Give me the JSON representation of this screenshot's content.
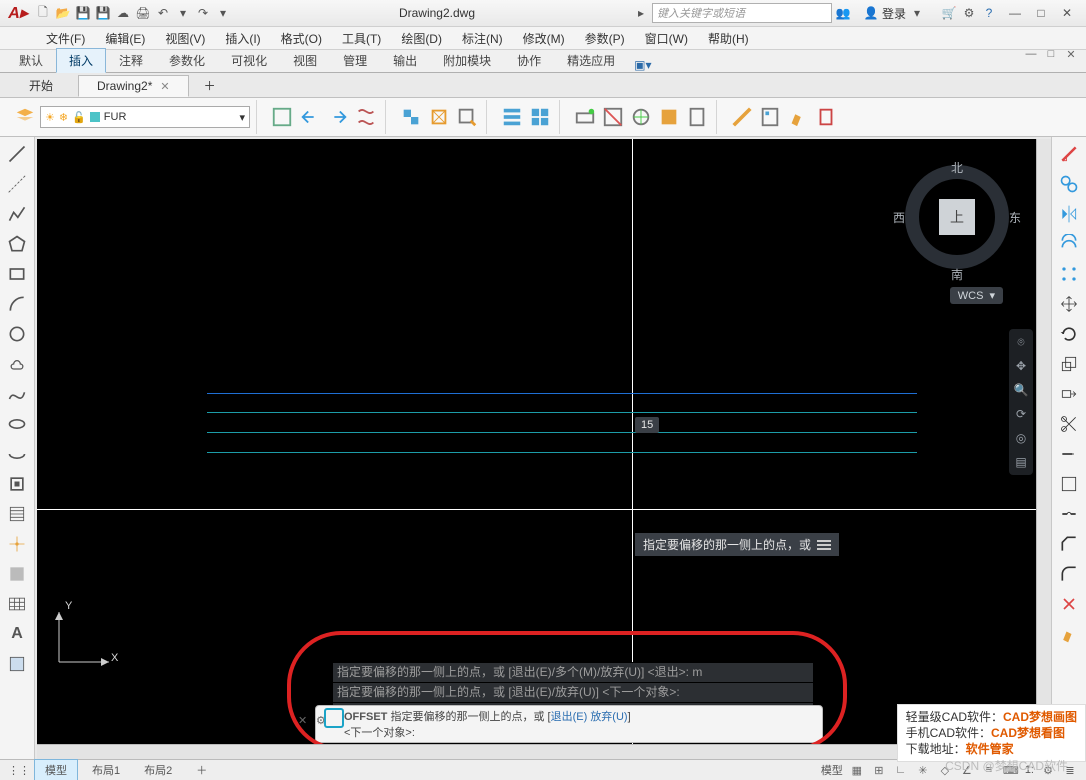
{
  "title": "Drawing2.dwg",
  "search_placeholder": "键入关键字或短语",
  "login": "登录",
  "menus": [
    "文件(F)",
    "编辑(E)",
    "视图(V)",
    "插入(I)",
    "格式(O)",
    "工具(T)",
    "绘图(D)",
    "标注(N)",
    "修改(M)",
    "参数(P)",
    "窗口(W)",
    "帮助(H)"
  ],
  "ribbon_tabs": [
    "默认",
    "插入",
    "注释",
    "参数化",
    "可视化",
    "视图",
    "管理",
    "输出",
    "附加模块",
    "协作",
    "精选应用"
  ],
  "ribbon_active_index": 1,
  "doc_tabs": {
    "start": "开始",
    "active": "Drawing2*"
  },
  "layer_name": "FUR",
  "dim_label": "15",
  "dyn_tooltip": "指定要偏移的那一侧上的点，或",
  "cmd_history": [
    "指定要偏移的那一侧上的点，或 [退出(E)/多个(M)/放弃(U)] <退出>:  m",
    "指定要偏移的那一侧上的点，或 [退出(E)/放弃(U)] <下一个对象>:",
    "指定要偏移的那一侧上的点，或 [退出(E)/放弃(U)] <下一个对象>:"
  ],
  "cmd_line": {
    "cmd": "OFFSET",
    "body": "指定要偏移的那一侧上的点，或 [",
    "opt1": "退出(E)",
    "sep": " ",
    "opt2": "放弃(U)",
    "close": "]",
    "next": "<下一个对象>:"
  },
  "nav": {
    "top": "北",
    "bottom": "南",
    "left": "西",
    "right": "东",
    "face": "上",
    "wcs": "WCS"
  },
  "ucs": {
    "x": "X",
    "y": "Y"
  },
  "status_tabs": [
    "模型",
    "布局1",
    "布局2"
  ],
  "status_right": {
    "model": "模型",
    "scale": "1:"
  },
  "ad": {
    "l1a": "轻量级CAD软件：",
    "l1b": "CAD梦想画图",
    "l2a": "手机CAD软件：",
    "l2b": "CAD梦想看图",
    "l3a": "下载地址：",
    "l3b": "软件管家"
  },
  "csdn": "CSDN @梦想CAD软件"
}
